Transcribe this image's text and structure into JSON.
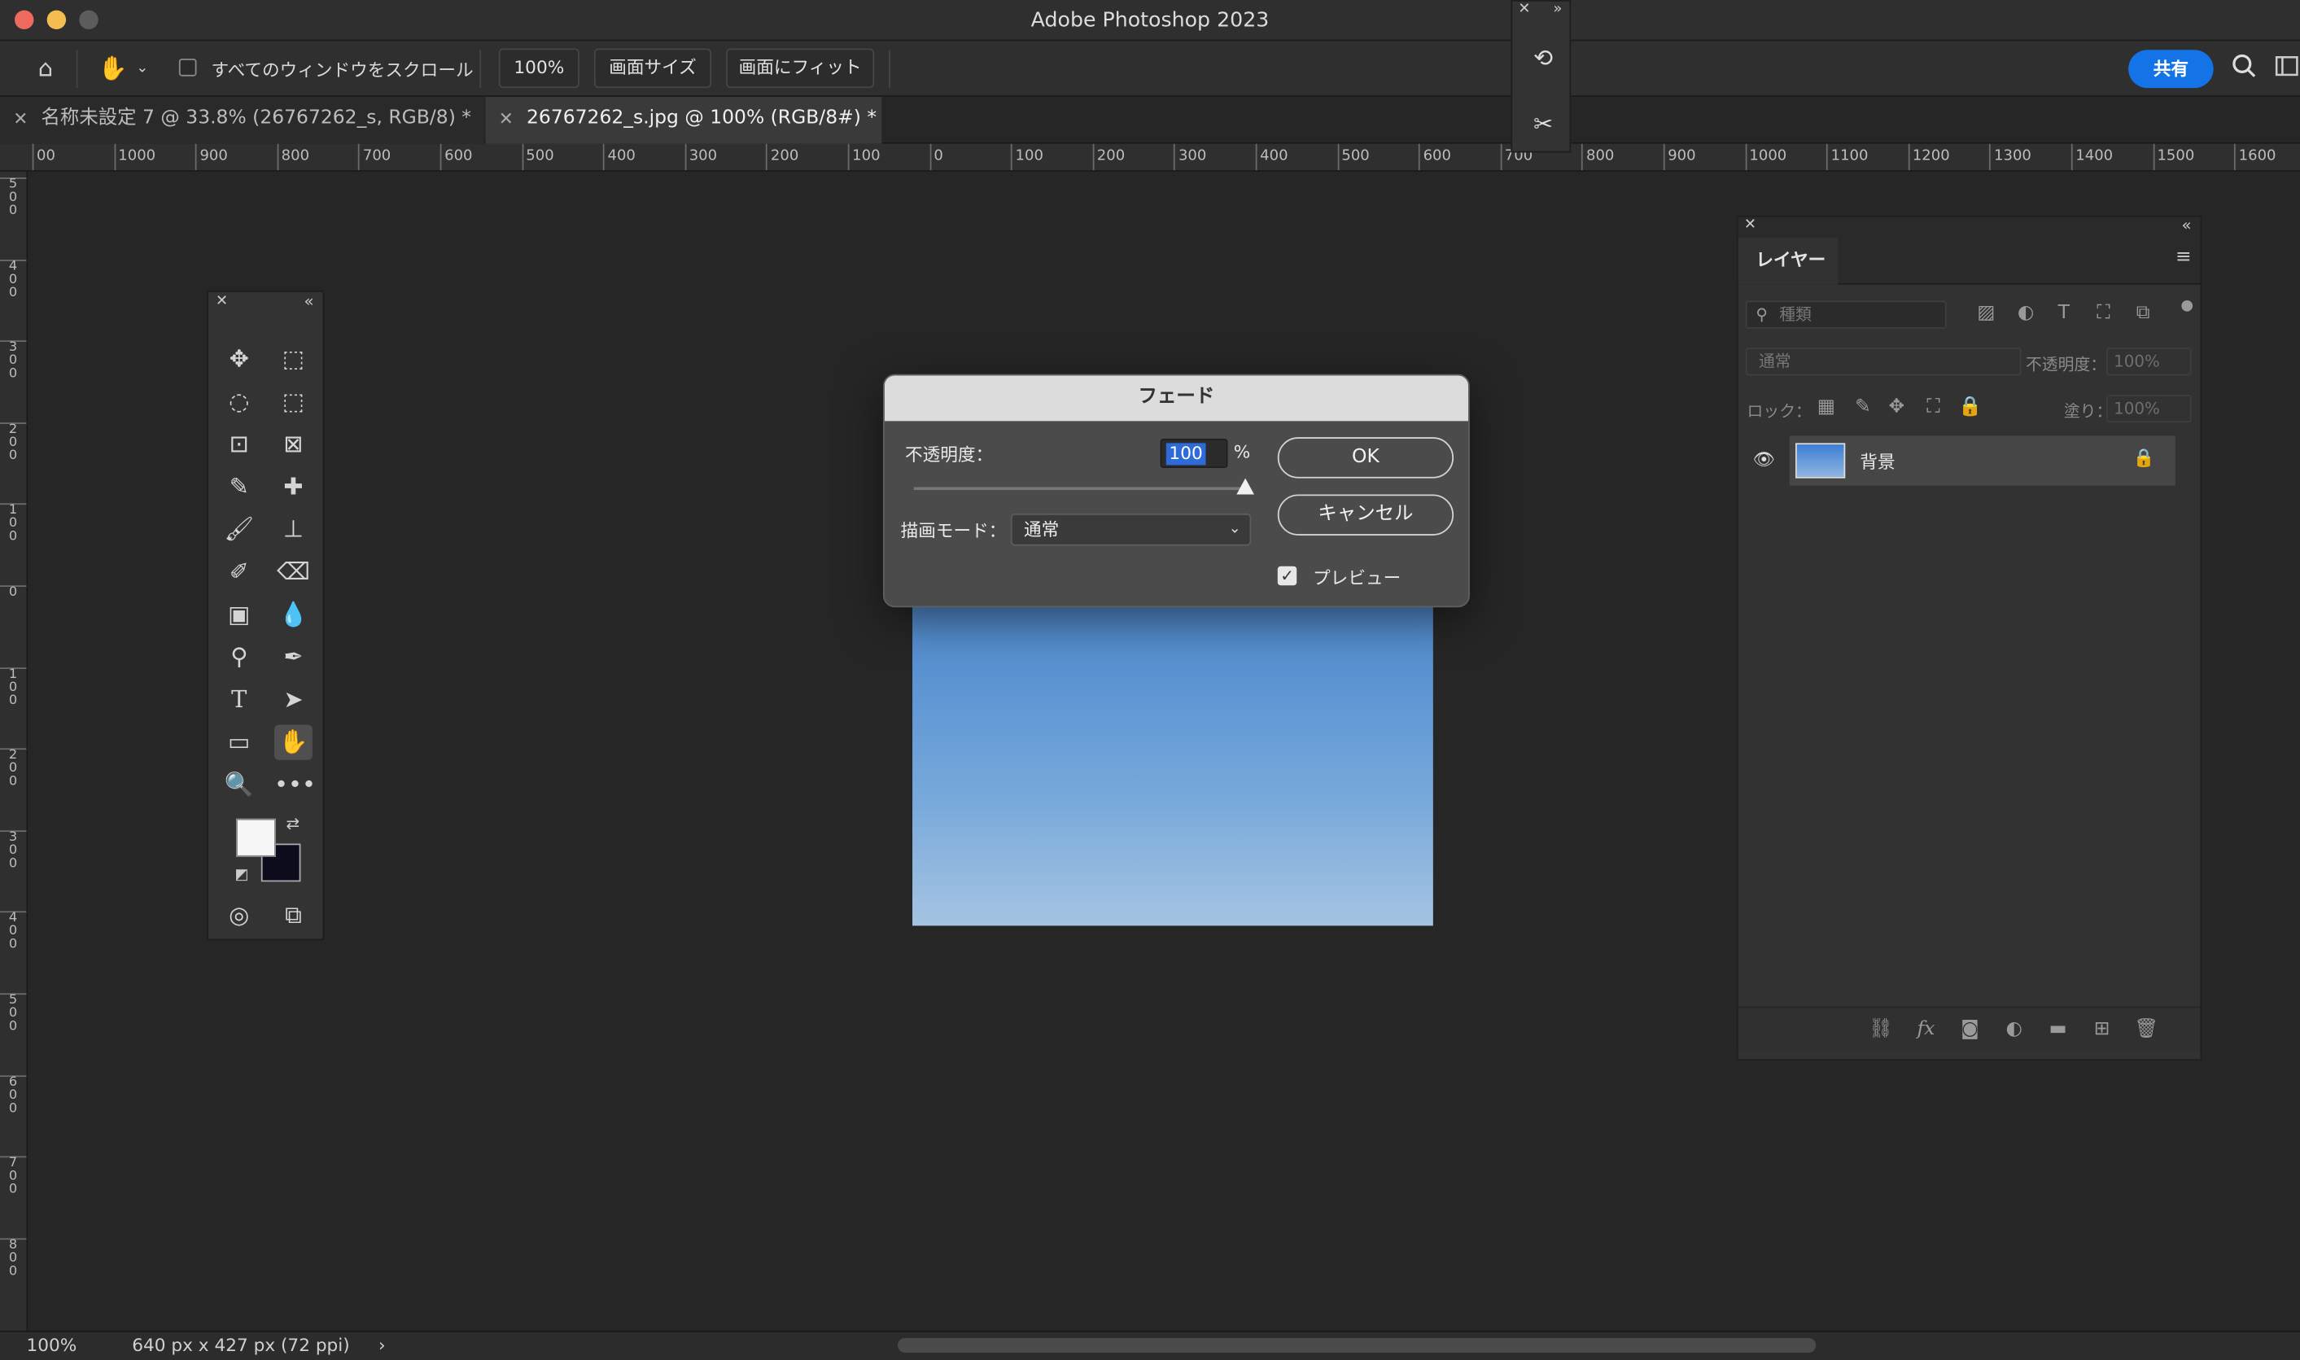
{
  "app": {
    "title": "Adobe Photoshop 2023"
  },
  "options_bar": {
    "scroll_all_label": "すべてのウィンドウをスクロール",
    "zoom_button": "100%",
    "actual_size_button": "画面サイズ",
    "fit_screen_button": "画面にフィット",
    "share_button": "共有"
  },
  "tabs": [
    {
      "label": "名称未設定 7 @ 33.8% (26767262_s, RGB/8) *",
      "active": false
    },
    {
      "label": "26767262_s.jpg @ 100% (RGB/8#) *",
      "active": true
    }
  ],
  "ruler_h": [
    "00",
    "1000",
    "900",
    "800",
    "700",
    "600",
    "500",
    "400",
    "300",
    "200",
    "100",
    "0",
    "100",
    "200",
    "300",
    "400",
    "500",
    "600",
    "700",
    "800",
    "900",
    "1000",
    "1100",
    "1200",
    "1300",
    "1400",
    "1500",
    "1600"
  ],
  "ruler_v": [
    "500",
    "400",
    "300",
    "200",
    "100",
    "0",
    "100",
    "200",
    "300",
    "400",
    "500",
    "600",
    "700",
    "800"
  ],
  "dialog": {
    "title": "フェード",
    "opacity_label": "不透明度：",
    "opacity_value": "100",
    "opacity_level": 100,
    "percent": "%",
    "mode_label": "描画モード：",
    "mode_value": "通常",
    "ok_button": "OK",
    "cancel_button": "キャンセル",
    "preview_label": "プレビュー",
    "preview_checked": true
  },
  "layers_panel": {
    "tab": "レイヤー",
    "filter_placeholder": "種類",
    "blend_mode": "通常",
    "opacity_label": "不透明度：",
    "opacity_value": "100%",
    "lock_label": "ロック：",
    "fill_label": "塗り：",
    "fill_value": "100%",
    "layers": [
      {
        "name": "背景",
        "visible": true,
        "locked": true
      }
    ]
  },
  "status": {
    "zoom": "100%",
    "doc_info": "640 px x 427 px (72 ppi)"
  },
  "colors": {
    "accent": "#1473e6",
    "foreground": "#f7f7f7",
    "background": "#0c0c1c"
  }
}
